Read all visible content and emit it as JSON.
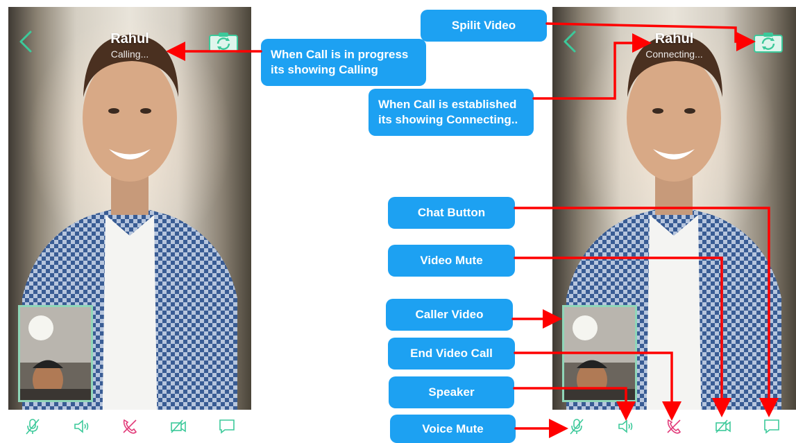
{
  "left_screen": {
    "caller_name": "Rahul",
    "call_status": "Calling..."
  },
  "right_screen": {
    "caller_name": "Rahul",
    "call_status": "Connecting..."
  },
  "controls": [
    {
      "icon": "microphone-muted-icon"
    },
    {
      "icon": "speaker-icon"
    },
    {
      "icon": "end-call-icon"
    },
    {
      "icon": "video-muted-icon"
    },
    {
      "icon": "chat-icon"
    }
  ],
  "annotations": {
    "split_video": "Spilit Video",
    "calling_note": "When Call is in progress its showing Calling",
    "connecting_note": "When Call is established its showing Connecting..",
    "chat_button": "Chat Button",
    "video_mute": "Video Mute",
    "caller_video": "Caller Video",
    "end_video_call": "End Video Call",
    "speaker": "Speaker",
    "voice_mute": "Voice Mute"
  },
  "colors": {
    "accent_green": "#3cc99a",
    "end_call_pink": "#e23b7a",
    "callout_blue": "#1da1f2",
    "arrow_red": "#ff0000"
  }
}
